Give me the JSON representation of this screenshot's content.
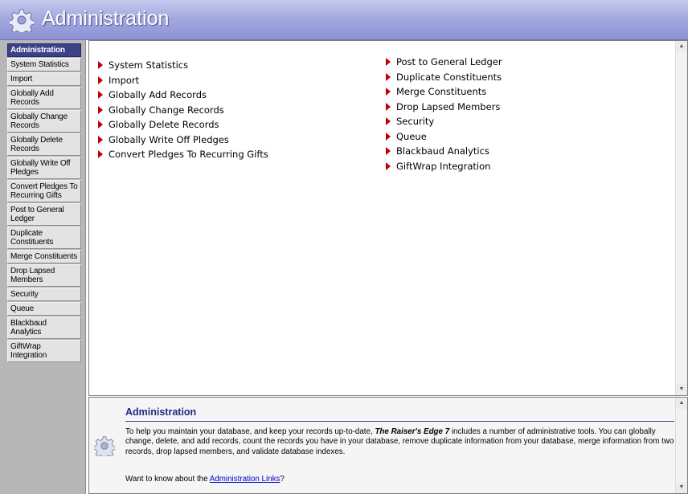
{
  "header": {
    "title": "Administration",
    "icon": "gear-icon"
  },
  "sidebar": {
    "items": [
      {
        "label": "Administration",
        "active": true
      },
      {
        "label": "System Statistics"
      },
      {
        "label": "Import"
      },
      {
        "label": "Globally Add Records"
      },
      {
        "label": "Globally Change Records"
      },
      {
        "label": "Globally Delete Records"
      },
      {
        "label": "Globally Write Off Pledges"
      },
      {
        "label": "Convert Pledges To Recurring Gifts"
      },
      {
        "label": "Post to General Ledger"
      },
      {
        "label": "Duplicate Constituents"
      },
      {
        "label": "Merge Constituents"
      },
      {
        "label": "Drop Lapsed Members"
      },
      {
        "label": "Security"
      },
      {
        "label": "Queue"
      },
      {
        "label": "Blackbaud Analytics"
      },
      {
        "label": "GiftWrap Integration"
      }
    ]
  },
  "main": {
    "left_links": [
      "System Statistics",
      "Import",
      "Globally Add Records",
      "Globally Change Records",
      "Globally Delete Records",
      "Globally Write Off Pledges",
      "Convert Pledges To Recurring Gifts"
    ],
    "right_links": [
      "Post to General Ledger",
      "Duplicate Constituents",
      "Merge Constituents",
      "Drop Lapsed Members",
      "Security",
      "Queue",
      "Blackbaud Analytics",
      "GiftWrap Integration"
    ]
  },
  "help": {
    "title": "Administration",
    "body_before": "To help you maintain your database, and keep your records up-to-date, ",
    "body_product": "The Raiser's Edge 7",
    "body_after": " includes a number of administrative tools. You can globally change, delete, and add records, count the records you have in your database, remove duplicate information from your database, merge information from two records, drop lapsed members, and validate database indexes.",
    "link_prefix": "Want to know about the ",
    "link_text": "Administration Links",
    "link_suffix": "?"
  },
  "colors": {
    "title_bar": "#9aa0dc",
    "sidebar_active": "#3b4188",
    "arrow": "#c00000",
    "help_title": "#1f2a80",
    "link": "#0000cc"
  }
}
